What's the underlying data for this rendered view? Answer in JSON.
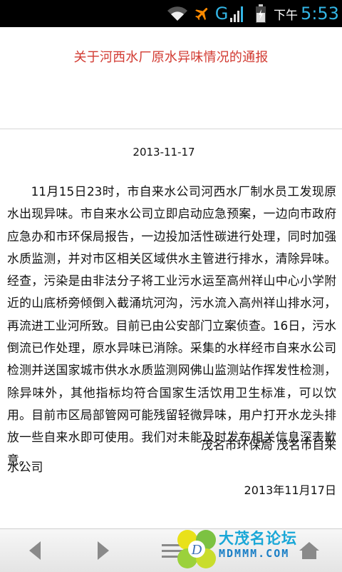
{
  "status_bar": {
    "network_type": "G",
    "ampm": "下午",
    "time": "5:53",
    "accent_color": "#33b5e5",
    "icons": [
      "wifi-icon",
      "airplane-icon",
      "signal-icon",
      "battery-icon"
    ]
  },
  "article": {
    "title": "关于河西水厂原水异味情况的通报",
    "title_color": "#d23a31",
    "date": "2013-11-17",
    "body": "11月15日23时，市自来水公司河西水厂制水员工发现原水出现异味。市自来水公司立即启动应急预案，一边向市政府应急办和市环保局报告，一边投加活性碳进行处理，同时加强水质监测，并对市区相关区域供水主管进行排水，清除异味。经查，污染是由非法分子将工业污水运至高州祥山中心小学附近的山底桥旁倾倒入截涌坑河沟，污水流入高州祥山排水河，再流进工业河所致。目前已由公安部门立案侦查。16日，污水倒流已作处理，原水异味已消除。采集的水样经市自来水公司检测并送国家城市供水水质监测网佛山监测站作挥发性检测，除异味外，其他指标均符合国家生活饮用卫生标准，可以饮用。目前市区局部管网可能残留轻微异味，用户打开水龙头排放一些自来水即可使用。我们对未能及时发布相关信息深表歉意。",
    "signature_line1": "茂名市环保局 茂名市自来",
    "signature_line2": "水公司",
    "signature_date": "2013年11月17日"
  },
  "bottom_bar": {
    "buttons": [
      "back",
      "forward",
      "menu",
      "home"
    ],
    "logo_cn": "大茂名论坛",
    "logo_en": "MDMMM.COM"
  }
}
